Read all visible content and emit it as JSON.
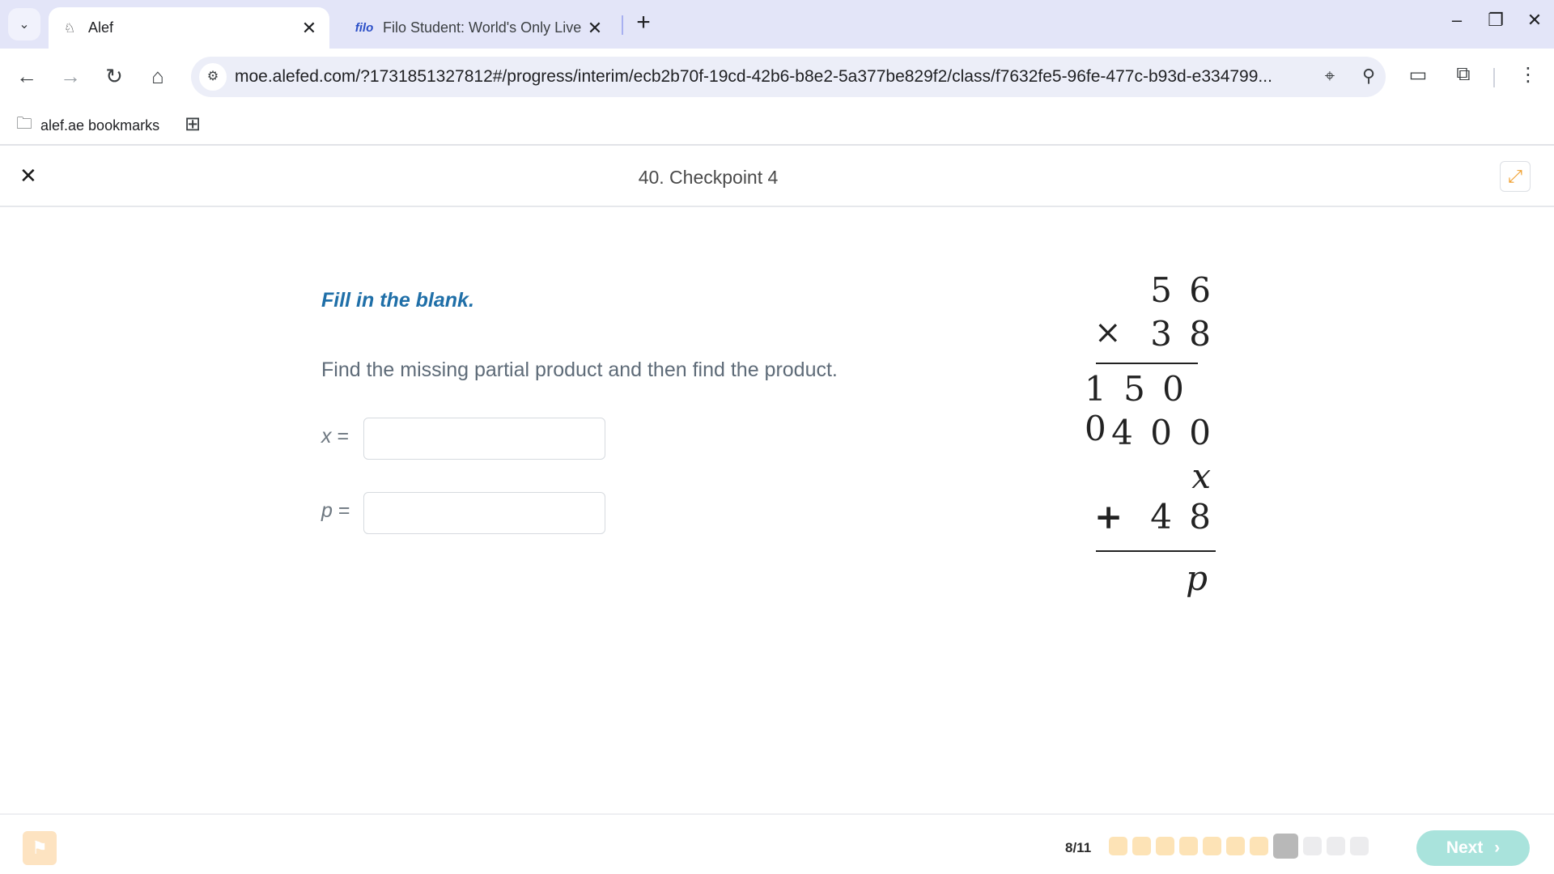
{
  "browser": {
    "tabs": [
      {
        "label": "Alef",
        "favicon": "alef-icon",
        "active": true
      },
      {
        "label": "Filo Student: World's Only Live I",
        "favicon_text": "filo",
        "active": false
      }
    ],
    "url": "moe.alefed.com/?1731851327812#/progress/interim/ecb2b70f-19cd-42b6-b8e2-5a377be829f2/class/f7632fe5-96fe-477c-b93d-e334799...",
    "bookmarks": [
      {
        "label": "alef.ae bookmarks"
      }
    ]
  },
  "app": {
    "page_title": "40. Checkpoint 4",
    "instruction": "Fill in the blank.",
    "question": "Find the missing partial product and then find the product.",
    "fields": [
      {
        "var": "x",
        "eq": " =",
        "value": ""
      },
      {
        "var": "p",
        "eq": " =",
        "value": ""
      }
    ],
    "multiplication": {
      "multiplicand": "5 6",
      "times_symbol": "×",
      "multiplier": "3 8",
      "partials": [
        "1 5 0 0",
        "4 0 0",
        "x"
      ],
      "plus_symbol": "+",
      "last_partial": "4 8",
      "product": "p"
    }
  },
  "footer": {
    "progress_label": "8/11",
    "progress": {
      "completed": 7,
      "current": 8,
      "total": 11
    },
    "next_label": "Next",
    "next_arrow": "›"
  },
  "colors": {
    "instruction": "#1f6fa8",
    "next_button": "#a9e3dc",
    "dot_done": "#fde3b6",
    "dot_current": "#b8b8b8",
    "dot_todo": "#ececee",
    "expand_icon": "#f0a030"
  }
}
